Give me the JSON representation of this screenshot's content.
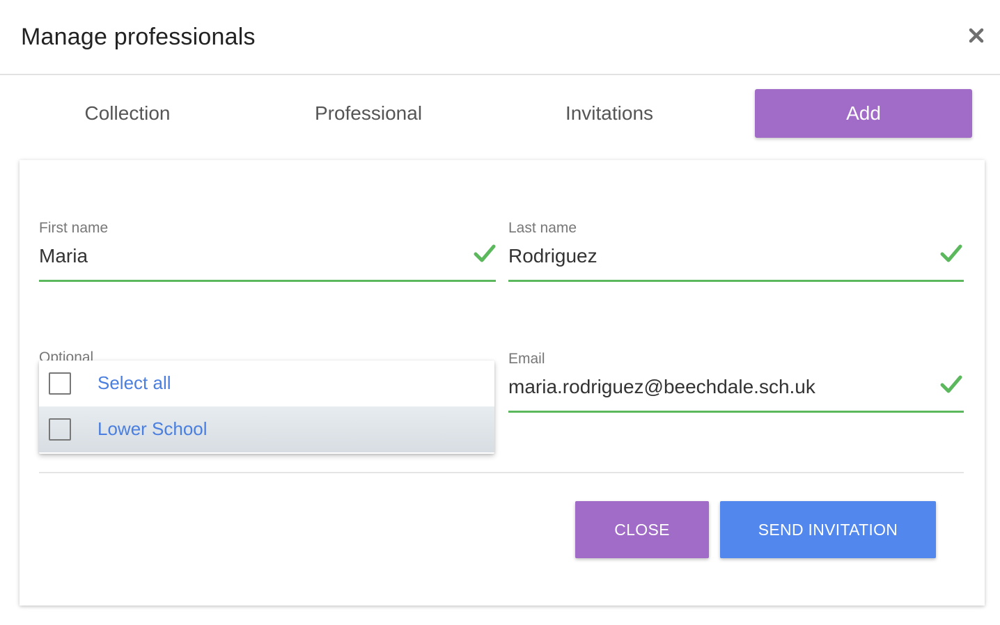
{
  "dialog": {
    "title": "Manage professionals",
    "close_icon": "close-icon"
  },
  "tabs": [
    {
      "label": "Collection",
      "active": false
    },
    {
      "label": "Professional",
      "active": false
    },
    {
      "label": "Invitations",
      "active": false
    },
    {
      "label": "Add",
      "active": true
    }
  ],
  "form": {
    "first_name": {
      "label": "First name",
      "value": "Maria",
      "valid": true
    },
    "last_name": {
      "label": "Last name",
      "value": "Rodriguez",
      "valid": true
    },
    "optional": {
      "label": "Optional"
    },
    "email": {
      "label": "Email",
      "value": "maria.rodriguez@beechdale.sch.uk",
      "valid": true
    }
  },
  "dropdown": {
    "items": [
      {
        "label": "Select all",
        "checked": false
      },
      {
        "label": "Lower School",
        "checked": false
      }
    ]
  },
  "actions": {
    "close_label": "CLOSE",
    "send_label": "SEND INVITATION"
  },
  "colors": {
    "accent_purple": "#a06cc7",
    "primary_blue": "#5287ed",
    "valid_green": "#5cb85c",
    "link_blue": "#4a7fe0"
  }
}
